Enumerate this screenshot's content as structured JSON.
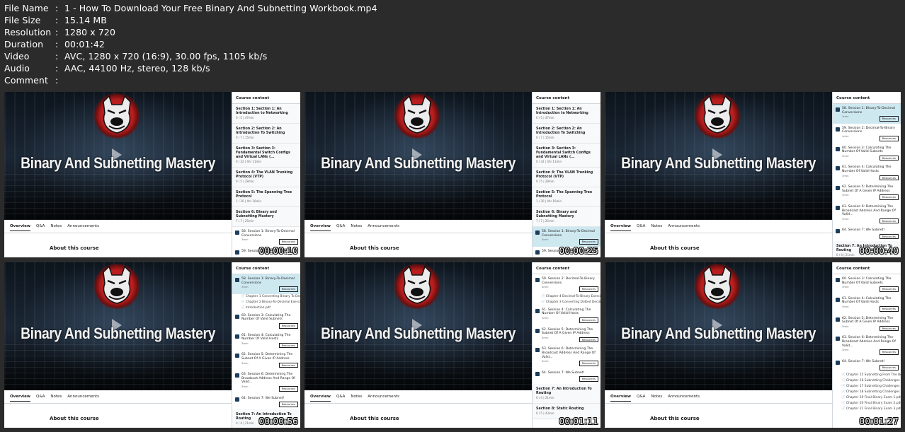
{
  "metadata": [
    {
      "key": "File Name",
      "value": "1 - How To Download Your Free Binary And Subnetting Workbook.mp4"
    },
    {
      "key": "File Size",
      "value": "15.14 MB"
    },
    {
      "key": "Resolution",
      "value": "1280 x 720"
    },
    {
      "key": "Duration",
      "value": "00:01:42"
    },
    {
      "key": "Video",
      "value": "AVC, 1280 x 720 (16:9), 30.00 fps, 1105 kb/s"
    },
    {
      "key": "Audio",
      "value": "AAC, 44100 Hz, stereo, 128 kb/s"
    },
    {
      "key": "Comment",
      "value": ""
    }
  ],
  "separator": ":",
  "video_title": "Binary And Subnetting Mastery",
  "course_content_label": "Course content",
  "tabs": [
    "Overview",
    "Q&A",
    "Notes",
    "Announcements"
  ],
  "about_label": "About this course",
  "resources_label": "Resources",
  "thumbs": [
    {
      "time": "00:00:10",
      "side": [
        {
          "t": "sec",
          "title": "Section 1: Section 1: An Introduction to Networking",
          "sub": "0 / 5 | 47min"
        },
        {
          "t": "sec",
          "title": "Section 2: Section 2: An Introduction To Switching",
          "sub": "0 / 7 | 15min"
        },
        {
          "t": "sec",
          "title": "Section 3: Section 3: Fundamental Switch Configs and Virtual LANs (...",
          "sub": "0 / 32 | 4hr 11min"
        },
        {
          "t": "sec",
          "title": "Section 4: The VLAN Trunking Protocol (VTP)",
          "sub": "0 / 5 | 28min"
        },
        {
          "t": "sec",
          "title": "Section 5: The Spanning Tree Protocol",
          "sub": "1 / 30 | 4hr 16min"
        },
        {
          "t": "sec",
          "title": "Section 6: Binary and Subnetting Mastery",
          "sub": "7 / 7 | 25min"
        },
        {
          "t": "lec",
          "title": "58. Session 1: Binary-To-Decimal Conversions",
          "sub": "3min",
          "res": true,
          "cur": false
        },
        {
          "t": "lec",
          "title": "59. Session 2: Decimal-To-Binary",
          "sub": "",
          "res": false,
          "cur": false
        }
      ]
    },
    {
      "time": "00:00:25",
      "side": [
        {
          "t": "sec",
          "title": "Section 1: Section 1: An Introduction to Networking",
          "sub": "0 / 5 | 47min"
        },
        {
          "t": "sec",
          "title": "Section 2: Section 2: An Introduction To Switching",
          "sub": "0 / 7 | 15min"
        },
        {
          "t": "sec",
          "title": "Section 3: Section 3: Fundamental Switch Configs and Virtual LANs (...",
          "sub": "0 / 32 | 4hr 11min"
        },
        {
          "t": "sec",
          "title": "Section 4: The VLAN Trunking Protocol (VTP)",
          "sub": "0 / 5 | 28min"
        },
        {
          "t": "sec",
          "title": "Section 5: The Spanning Tree Protocol",
          "sub": "1 / 30 | 4hr 16min"
        },
        {
          "t": "sec",
          "title": "Section 6: Binary and Subnetting Mastery",
          "sub": "7 / 7 | 25min"
        },
        {
          "t": "lec",
          "title": "58. Session 1: Binary-To-Decimal Conversions",
          "sub": "3min",
          "res": true,
          "cur": true
        },
        {
          "t": "lec",
          "title": "59. Session 2: Decimal-To-Binary",
          "sub": "",
          "res": false,
          "cur": false
        }
      ]
    },
    {
      "time": "00:00:40",
      "side": [
        {
          "t": "lec",
          "title": "58. Session 1: Binary-To-Decimal Conversions",
          "sub": "3min",
          "res": true,
          "cur": true
        },
        {
          "t": "lec",
          "title": "59. Session 2: Decimal-To-Binary Conversions",
          "sub": "4min",
          "res": true,
          "cur": false
        },
        {
          "t": "lec",
          "title": "60. Session 3: Calculating The Number Of Valid Subnets",
          "sub": "3min",
          "res": true,
          "cur": false
        },
        {
          "t": "lec",
          "title": "61. Session 4: Calculating The Number Of Valid Hosts",
          "sub": "3min",
          "res": true,
          "cur": false
        },
        {
          "t": "lec",
          "title": "62. Session 5: Determining The Subnet Of A Given IP Address",
          "sub": "3min",
          "res": true,
          "cur": false
        },
        {
          "t": "lec",
          "title": "63. Session 6: Determining The Broadcast Address And Range Of Valid...",
          "sub": "3min",
          "res": true,
          "cur": false
        },
        {
          "t": "lec",
          "title": "64. Session 7: We Subnet!",
          "sub": "",
          "res": true,
          "cur": false
        },
        {
          "t": "sec",
          "title": "Section 7: An Introduction To Routing",
          "sub": "0 / 4 | 21min"
        }
      ]
    },
    {
      "time": "00:00:56",
      "side": [
        {
          "t": "lec",
          "title": "58. Session 1: Binary-To-Decimal Conversions",
          "sub": "3min",
          "res": true,
          "cur": true
        },
        {
          "t": "file",
          "title": "Chapter 1 Converting Binary To Dec"
        },
        {
          "t": "file",
          "title": "Chapter 2 Binary-To-Decimal Exercis"
        },
        {
          "t": "file",
          "title": "Introduction.pdf"
        },
        {
          "t": "lec",
          "title": "60. Session 3: Calculating The Number Of Valid Subnets",
          "sub": "",
          "res": true,
          "cur": false
        },
        {
          "t": "lec",
          "title": "61. Session 4: Calculating The Number Of Valid Hosts",
          "sub": "3min",
          "res": true,
          "cur": false
        },
        {
          "t": "lec",
          "title": "62. Session 5: Determining The Subnet Of A Given IP Address",
          "sub": "3min",
          "res": true,
          "cur": false
        },
        {
          "t": "lec",
          "title": "63. Session 6: Determining The Broadcast Address And Range Of Valid...",
          "sub": "3min",
          "res": true,
          "cur": false
        },
        {
          "t": "lec",
          "title": "64. Session 7: We Subnet!",
          "sub": "",
          "res": true,
          "cur": false
        },
        {
          "t": "sec",
          "title": "Section 7: An Introduction To Routing",
          "sub": "0 / 4 | 21min"
        }
      ]
    },
    {
      "time": "00:01:11",
      "side": [
        {
          "t": "lec",
          "title": "59. Session 2: Decimal-To-Binary Conversions",
          "sub": "4min",
          "res": true,
          "cur": false
        },
        {
          "t": "file",
          "title": "Chapter 4 Decimal-To-Binary Exercis"
        },
        {
          "t": "file",
          "title": "Chapter 3 Converting Dotted Decim"
        },
        {
          "t": "lec",
          "title": "61. Session 4: Calculating The Number Of Valid Hosts",
          "sub": "3min",
          "res": true,
          "cur": false
        },
        {
          "t": "lec",
          "title": "62. Session 5: Determining The Subnet Of A Given IP Address",
          "sub": "3min",
          "res": true,
          "cur": false
        },
        {
          "t": "lec",
          "title": "63. Session 6: Determining The Broadcast Address And Range Of Valid...",
          "sub": "3min",
          "res": true,
          "cur": false
        },
        {
          "t": "lec",
          "title": "64. Session 7: We Subnet!",
          "sub": "",
          "res": true,
          "cur": false
        },
        {
          "t": "sec",
          "title": "Section 7: An Introduction To Routing",
          "sub": "0 / 4 | 21min"
        },
        {
          "t": "sec",
          "title": "Section 8: Static Routing",
          "sub": "0 / 5 | 43min"
        }
      ]
    },
    {
      "time": "00:01:27",
      "side": [
        {
          "t": "lec",
          "title": "60. Session 3: Calculating The Number Of Valid Subnets",
          "sub": "3min",
          "res": true,
          "cur": false
        },
        {
          "t": "lec",
          "title": "61. Session 4: Calculating The Number Of Valid Hosts",
          "sub": "3min",
          "res": true,
          "cur": false
        },
        {
          "t": "lec",
          "title": "62. Session 5: Determining The Subnet Of A Given IP Address",
          "sub": "3min",
          "res": true,
          "cur": false
        },
        {
          "t": "lec",
          "title": "63. Session 6: Determining The Broadcast Address And Range Of Valid...",
          "sub": "3min",
          "res": true,
          "cur": false
        },
        {
          "t": "lec",
          "title": "64. Session 7: We Subnet!",
          "sub": "",
          "res": true,
          "cur": false
        },
        {
          "t": "file",
          "title": "Chapter 15 Subnetting From The Bo"
        },
        {
          "t": "file",
          "title": "Chapter 16 Subnetting Challenges 1"
        },
        {
          "t": "file",
          "title": "Chapter 17 Subnetting Challenges 2"
        },
        {
          "t": "file",
          "title": "Chapter 18 Subnetting Challenges 3"
        },
        {
          "t": "file",
          "title": "Chapter 19 Final Binary Exam 1.pdf"
        },
        {
          "t": "file",
          "title": "Chapter 20 Final Binary Exam 2.pdf"
        },
        {
          "t": "file",
          "title": "Chapter 21 Final Binary Exam 3.pdf"
        }
      ]
    }
  ]
}
